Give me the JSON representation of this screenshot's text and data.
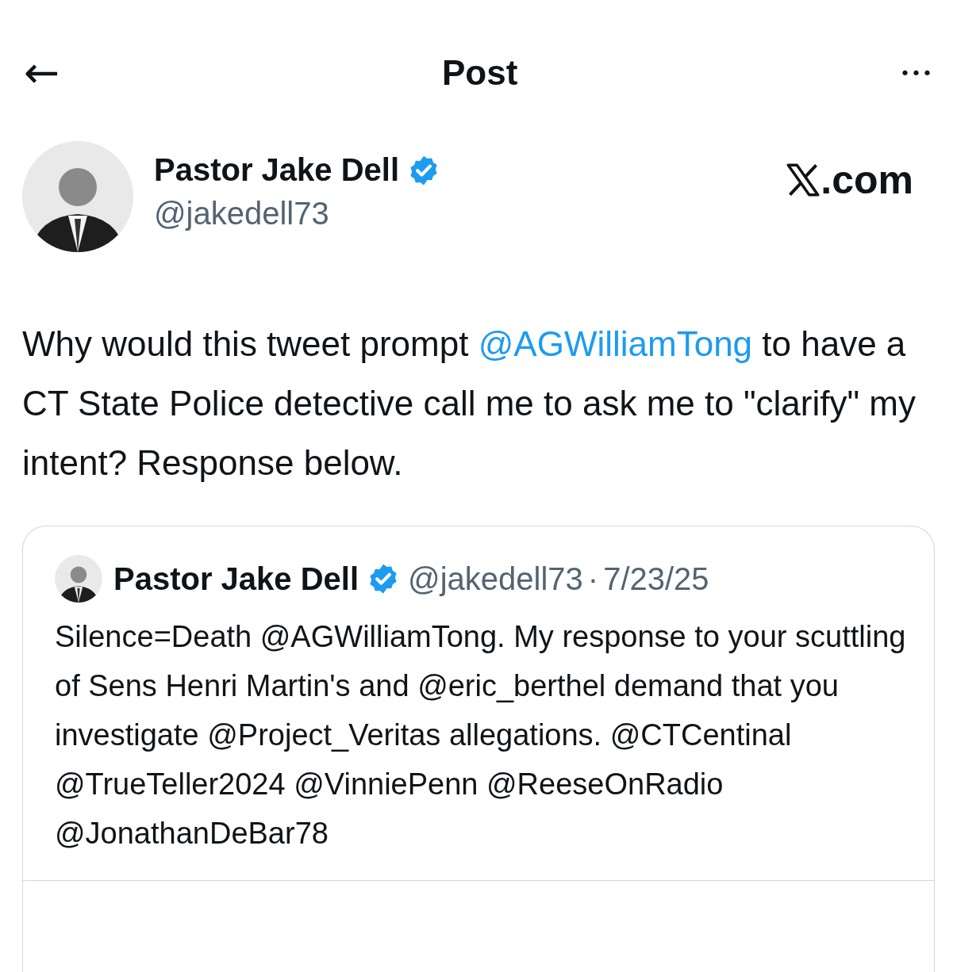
{
  "header": {
    "title": "Post",
    "back": "←",
    "more": "•••"
  },
  "author": {
    "name": "Pastor Jake Dell",
    "verified": true,
    "handle": "@jakedell73",
    "site": ".com"
  },
  "post": {
    "text_before": "Why would this tweet prompt",
    "mention": "@AGWilliamTong",
    "text_after": "to have a CT State Police detective call me to ask me to \"clarify\" my intent? Response below."
  },
  "quoted_post": {
    "name": "Pastor Jake Dell",
    "verified": true,
    "handle": "@jakedell73",
    "separator": "·",
    "date": "7/23/25",
    "text": "Silence=Death @AGWilliamTong. My response to your scuttling of Sens Henri Martin's and @eric_berthel demand that you investigate @Project_Veritas allegations. @CTCentinal @TrueTeller2024 @VinniePenn @ReeseOnRadio @JonathanDeBar78"
  }
}
